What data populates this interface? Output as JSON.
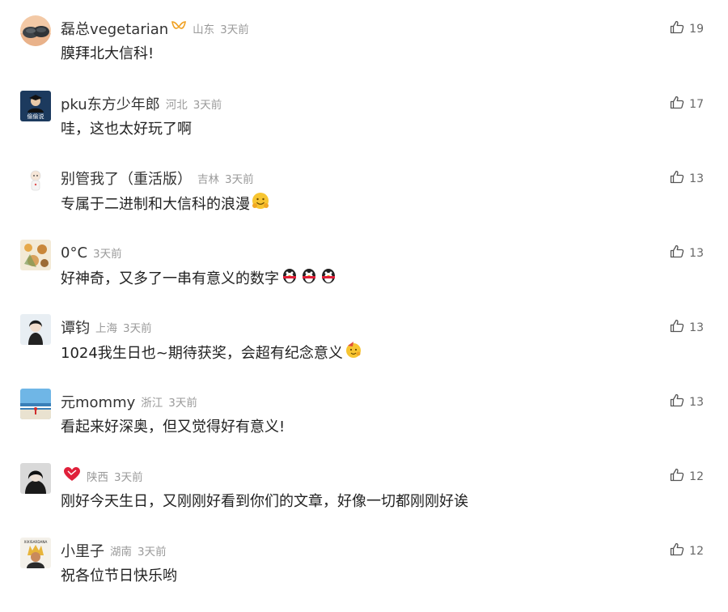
{
  "comments": [
    {
      "user": "磊总vegetarian",
      "region": "山东",
      "time": "3天前",
      "text": "膜拜北大信科!",
      "likes": "19"
    },
    {
      "user": "pku东方少年郎",
      "region": "河北",
      "time": "3天前",
      "text": "哇，这也太好玩了啊",
      "likes": "17"
    },
    {
      "user": "别管我了（重活版）",
      "region": "吉林",
      "time": "3天前",
      "text": "专属于二进制和大信科的浪漫",
      "likes": "13"
    },
    {
      "user": "0°C",
      "region": "",
      "time": "3天前",
      "text": "好神奇，又多了一串有意义的数字",
      "likes": "13"
    },
    {
      "user": "谭钧",
      "region": "上海",
      "time": "3天前",
      "text": "1024我生日也~期待获奖，会超有纪念意义",
      "likes": "13"
    },
    {
      "user": "元mommy",
      "region": "浙江",
      "time": "3天前",
      "text": "看起来好深奥，但又觉得好有意义!",
      "likes": "13"
    },
    {
      "user": "",
      "region": "陕西",
      "time": "3天前",
      "text": "刚好今天生日，又刚刚好看到你们的文章，好像一切都刚刚好诶",
      "likes": "12"
    },
    {
      "user": "小里子",
      "region": "湖南",
      "time": "3天前",
      "text": "祝各位节日快乐哟",
      "likes": "12"
    }
  ],
  "avatar_texts": {
    "c1": "偷偷说",
    "c7": "XIXISARDANA"
  },
  "icons": {
    "like": "thumbs-up-icon",
    "badge": "gold-ribbon-icon",
    "heart": "red-heart-icon"
  },
  "colors": {
    "nickname": "#333333",
    "meta": "#9a9a9a",
    "like": "#666666",
    "badge": "#f0a020",
    "heart": "#e0203a"
  }
}
